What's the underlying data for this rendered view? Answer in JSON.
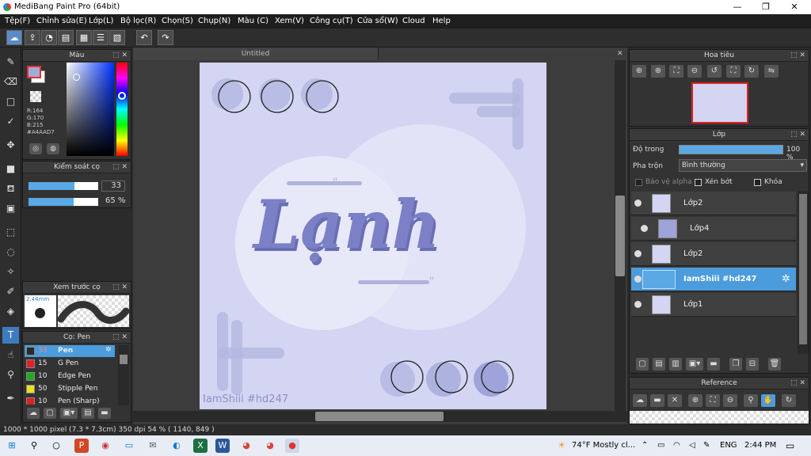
{
  "window": {
    "title": "MediBang Paint Pro (64bit)",
    "min": "—",
    "max": "❐",
    "close": "✕"
  },
  "menu": [
    "Tệp(F)",
    "Chỉnh sửa(E)",
    "Lớp(L)",
    "Bộ lọc(R)",
    "Chọn(S)",
    "Chụp(N)",
    "Màu (C)",
    "Xem(V)",
    "Công cụ(T)",
    "Cửa sổ(W)",
    "Cloud",
    "Help"
  ],
  "toolbar": {
    "cloud": "☁",
    "undo": "↶",
    "redo": "↷"
  },
  "color_panel": {
    "title": "Màu",
    "r": "R:164",
    "g": "G:170",
    "b": "B:215",
    "hex": "#A4AAD7",
    "main_color": "#a4aad7"
  },
  "brush_control": {
    "title": "Kiểm soát cọ",
    "size": "33",
    "opacity": "65 %",
    "size_fill": 0.66,
    "opacity_fill": 0.65
  },
  "brush_preview": {
    "title": "Xem trước cọ",
    "size": "2.44mm"
  },
  "brush_list": {
    "title": "Cọ: Pen",
    "items": [
      {
        "size": "33",
        "name": "Pen",
        "color": "#2a2a2a"
      },
      {
        "size": "15",
        "name": "G Pen",
        "color": "#dd2222"
      },
      {
        "size": "10",
        "name": "Edge Pen",
        "color": "#22aa22"
      },
      {
        "size": "50",
        "name": "Stipple Pen",
        "color": "#e8e020"
      },
      {
        "size": "10",
        "name": "Pen (Sharp)",
        "color": "#dd2222"
      }
    ]
  },
  "document": {
    "tab": "Untitled",
    "art_word": "Lạnh",
    "watermark": "IamShiii #hd247"
  },
  "navigator": {
    "title": "Hoa tiêu"
  },
  "layers": {
    "title": "Lớp",
    "opacity_label": "Độ trong",
    "opacity_value": "100 %",
    "blend_label": "Pha trộn",
    "blend_value": "Bình thường",
    "protect_alpha": "Bảo vệ alpha",
    "clipping": "Xén bớt",
    "lock": "Khóa",
    "items": [
      {
        "name": "Lớp2"
      },
      {
        "name": "Lớp4"
      },
      {
        "name": "Lớp2"
      },
      {
        "name": "IamShiii #hd247"
      },
      {
        "name": "Lớp1"
      }
    ]
  },
  "reference": {
    "title": "Reference"
  },
  "status": {
    "text": "1000 * 1000 pixel  (7.3 * 7.3cm)  350 dpi  54 %  ( 1140, 849 )"
  },
  "taskbar": {
    "weather": "74°F  Mostly cl...",
    "lang": "ENG",
    "time": "2:44 PM"
  }
}
